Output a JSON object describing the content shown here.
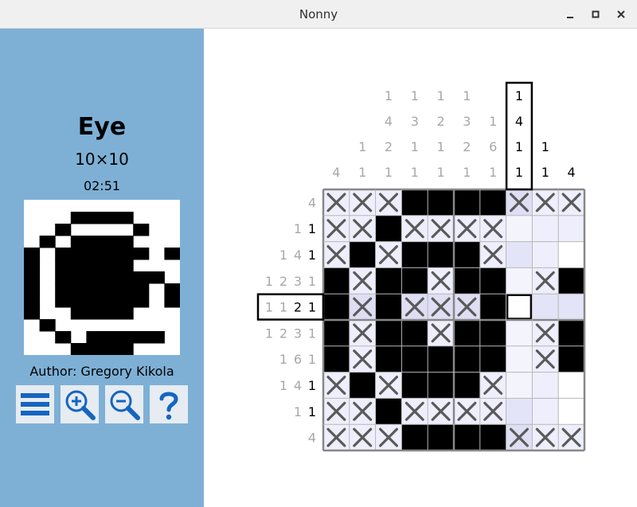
{
  "window": {
    "title": "Nonny"
  },
  "puzzle": {
    "title": "Eye",
    "size": "10×10",
    "timer": "02:51",
    "author": "Author: Gregory Kikola"
  },
  "toolbar": [
    {
      "name": "menu-button",
      "icon": "hamburger-menu-icon"
    },
    {
      "name": "zoom-in-button",
      "icon": "zoom-in-icon"
    },
    {
      "name": "zoom-out-button",
      "icon": "zoom-out-icon"
    },
    {
      "name": "help-button",
      "icon": "help-question-icon"
    }
  ],
  "colors": {
    "sidebar": "#7eb0d6",
    "accent": "#1565c0",
    "cell_highlight": "#eeeefc",
    "clue_done": "#a8a8a8",
    "clue_active": "#000000"
  },
  "board": {
    "column_clues": [
      [
        "4"
      ],
      [
        "1",
        "1"
      ],
      [
        "1",
        "4",
        "2",
        "1"
      ],
      [
        "1",
        "3",
        "1",
        "1"
      ],
      [
        "1",
        "2",
        "1",
        "1"
      ],
      [
        "1",
        "3",
        "2",
        "1"
      ],
      [
        "1",
        "6",
        "1"
      ],
      [
        "1",
        "4",
        "1",
        "1"
      ],
      [
        "1",
        "1"
      ],
      [
        "4"
      ]
    ],
    "column_clue_done": [
      [
        true
      ],
      [
        true,
        true
      ],
      [
        true,
        true,
        true,
        true
      ],
      [
        true,
        true,
        true,
        true
      ],
      [
        true,
        true,
        true,
        true
      ],
      [
        true,
        true,
        true,
        true
      ],
      [
        true,
        true,
        true
      ],
      [
        false,
        false,
        false,
        false
      ],
      [
        false,
        false
      ],
      [
        false
      ]
    ],
    "row_clues": [
      [
        "4"
      ],
      [
        "1",
        "1"
      ],
      [
        "1",
        "4",
        "1"
      ],
      [
        "1",
        "2",
        "3",
        "1"
      ],
      [
        "1",
        "1",
        "2",
        "1"
      ],
      [
        "1",
        "2",
        "3",
        "1"
      ],
      [
        "1",
        "6",
        "1"
      ],
      [
        "1",
        "4",
        "1"
      ],
      [
        "1",
        "1"
      ],
      [
        "4"
      ]
    ],
    "row_clue_done": [
      [
        true
      ],
      [
        true,
        false
      ],
      [
        true,
        true,
        false
      ],
      [
        true,
        true,
        true,
        true
      ],
      [
        true,
        true,
        false,
        false
      ],
      [
        true,
        true,
        true,
        true
      ],
      [
        true,
        true,
        true
      ],
      [
        true,
        true,
        false
      ],
      [
        true,
        false
      ],
      [
        true
      ]
    ],
    "cells": [
      "XXX####XXX",
      "XX#XXXX.bb",
      "X#X###Xbb.",
      "#X##X##.X#",
      "#X#XXX#pbb",
      "#X##X##.X#",
      "#X#####.X#",
      "X#X###X.b.",
      "XX#XXXXbb.",
      "XXX####XXX"
    ],
    "cursor_row": 4,
    "cursor_col": 7,
    "preview": [
      "..........",
      "...####...",
      "..#....#..",
      ".#.####...",
      "#.######.#",
      "#.#####...",
      "#.#######.",
      "#.######.#",
      "#.######.#",
      "#..####...",
      ".#.......",
      "..#.#####.",
      "...####..."
    ]
  }
}
